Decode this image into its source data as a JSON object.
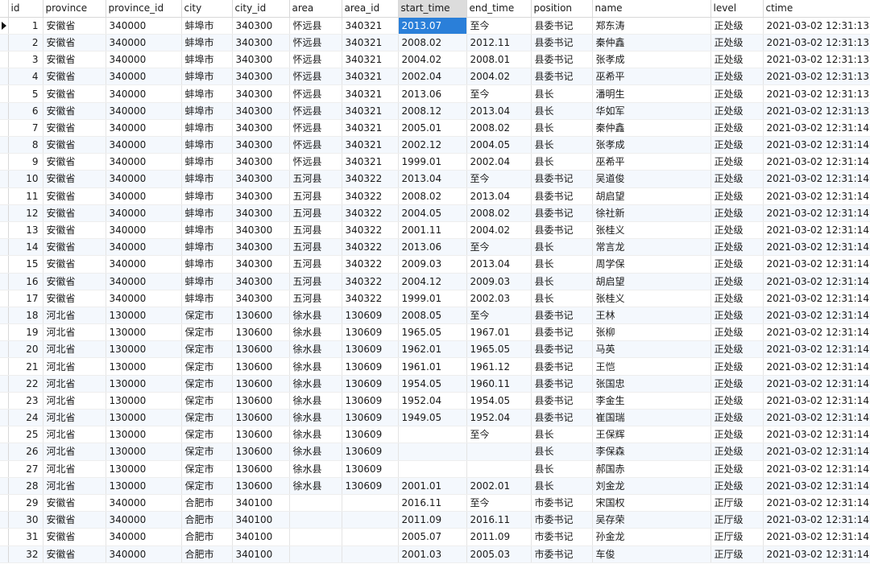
{
  "columns": [
    {
      "key": "id",
      "label": "id"
    },
    {
      "key": "province",
      "label": "province"
    },
    {
      "key": "province_id",
      "label": "province_id"
    },
    {
      "key": "city",
      "label": "city"
    },
    {
      "key": "city_id",
      "label": "city_id"
    },
    {
      "key": "area",
      "label": "area"
    },
    {
      "key": "area_id",
      "label": "area_id"
    },
    {
      "key": "start_time",
      "label": "start_time"
    },
    {
      "key": "end_time",
      "label": "end_time"
    },
    {
      "key": "position",
      "label": "position"
    },
    {
      "key": "name",
      "label": "name"
    },
    {
      "key": "level",
      "label": "level"
    },
    {
      "key": "ctime",
      "label": "ctime"
    }
  ],
  "sorted_column": "start_time",
  "current_row_index": 0,
  "selected_cell": {
    "row": 0,
    "column": "start_time"
  },
  "colors": {
    "selection": "#2a7fd9",
    "header_sorted": "#dcdcdc",
    "row_alt": "#f4f8fd"
  },
  "rows": [
    {
      "id": "1",
      "province": "安徽省",
      "province_id": "340000",
      "city": "蚌埠市",
      "city_id": "340300",
      "area": "怀远县",
      "area_id": "340321",
      "start_time": "2013.07",
      "end_time": "至今",
      "position": "县委书记",
      "name": "郑东涛",
      "level": "正处级",
      "ctime": "2021-03-02 12:31:13"
    },
    {
      "id": "2",
      "province": "安徽省",
      "province_id": "340000",
      "city": "蚌埠市",
      "city_id": "340300",
      "area": "怀远县",
      "area_id": "340321",
      "start_time": "2008.02",
      "end_time": "2012.11",
      "position": "县委书记",
      "name": "秦仲鑫",
      "level": "正处级",
      "ctime": "2021-03-02 12:31:13"
    },
    {
      "id": "3",
      "province": "安徽省",
      "province_id": "340000",
      "city": "蚌埠市",
      "city_id": "340300",
      "area": "怀远县",
      "area_id": "340321",
      "start_time": "2004.02",
      "end_time": "2008.01",
      "position": "县委书记",
      "name": "张孝成",
      "level": "正处级",
      "ctime": "2021-03-02 12:31:13"
    },
    {
      "id": "4",
      "province": "安徽省",
      "province_id": "340000",
      "city": "蚌埠市",
      "city_id": "340300",
      "area": "怀远县",
      "area_id": "340321",
      "start_time": "2002.04",
      "end_time": "2004.02",
      "position": "县委书记",
      "name": "巫希平",
      "level": "正处级",
      "ctime": "2021-03-02 12:31:13"
    },
    {
      "id": "5",
      "province": "安徽省",
      "province_id": "340000",
      "city": "蚌埠市",
      "city_id": "340300",
      "area": "怀远县",
      "area_id": "340321",
      "start_time": "2013.06",
      "end_time": "至今",
      "position": "县长",
      "name": "潘明生",
      "level": "正处级",
      "ctime": "2021-03-02 12:31:13"
    },
    {
      "id": "6",
      "province": "安徽省",
      "province_id": "340000",
      "city": "蚌埠市",
      "city_id": "340300",
      "area": "怀远县",
      "area_id": "340321",
      "start_time": "2008.12",
      "end_time": "2013.04",
      "position": "县长",
      "name": "华如军",
      "level": "正处级",
      "ctime": "2021-03-02 12:31:13"
    },
    {
      "id": "7",
      "province": "安徽省",
      "province_id": "340000",
      "city": "蚌埠市",
      "city_id": "340300",
      "area": "怀远县",
      "area_id": "340321",
      "start_time": "2005.01",
      "end_time": "2008.02",
      "position": "县长",
      "name": "秦仲鑫",
      "level": "正处级",
      "ctime": "2021-03-02 12:31:14"
    },
    {
      "id": "8",
      "province": "安徽省",
      "province_id": "340000",
      "city": "蚌埠市",
      "city_id": "340300",
      "area": "怀远县",
      "area_id": "340321",
      "start_time": "2002.12",
      "end_time": "2004.05",
      "position": "县长",
      "name": "张孝成",
      "level": "正处级",
      "ctime": "2021-03-02 12:31:14"
    },
    {
      "id": "9",
      "province": "安徽省",
      "province_id": "340000",
      "city": "蚌埠市",
      "city_id": "340300",
      "area": "怀远县",
      "area_id": "340321",
      "start_time": "1999.01",
      "end_time": "2002.04",
      "position": "县长",
      "name": "巫希平",
      "level": "正处级",
      "ctime": "2021-03-02 12:31:14"
    },
    {
      "id": "10",
      "province": "安徽省",
      "province_id": "340000",
      "city": "蚌埠市",
      "city_id": "340300",
      "area": "五河县",
      "area_id": "340322",
      "start_time": "2013.04",
      "end_time": "至今",
      "position": "县委书记",
      "name": "吴道俊",
      "level": "正处级",
      "ctime": "2021-03-02 12:31:14"
    },
    {
      "id": "11",
      "province": "安徽省",
      "province_id": "340000",
      "city": "蚌埠市",
      "city_id": "340300",
      "area": "五河县",
      "area_id": "340322",
      "start_time": "2008.02",
      "end_time": "2013.04",
      "position": "县委书记",
      "name": "胡启望",
      "level": "正处级",
      "ctime": "2021-03-02 12:31:14"
    },
    {
      "id": "12",
      "province": "安徽省",
      "province_id": "340000",
      "city": "蚌埠市",
      "city_id": "340300",
      "area": "五河县",
      "area_id": "340322",
      "start_time": "2004.05",
      "end_time": "2008.02",
      "position": "县委书记",
      "name": "徐社新",
      "level": "正处级",
      "ctime": "2021-03-02 12:31:14"
    },
    {
      "id": "13",
      "province": "安徽省",
      "province_id": "340000",
      "city": "蚌埠市",
      "city_id": "340300",
      "area": "五河县",
      "area_id": "340322",
      "start_time": "2001.11",
      "end_time": "2004.02",
      "position": "县委书记",
      "name": "张桂义",
      "level": "正处级",
      "ctime": "2021-03-02 12:31:14"
    },
    {
      "id": "14",
      "province": "安徽省",
      "province_id": "340000",
      "city": "蚌埠市",
      "city_id": "340300",
      "area": "五河县",
      "area_id": "340322",
      "start_time": "2013.06",
      "end_time": "至今",
      "position": "县长",
      "name": "常言龙",
      "level": "正处级",
      "ctime": "2021-03-02 12:31:14"
    },
    {
      "id": "15",
      "province": "安徽省",
      "province_id": "340000",
      "city": "蚌埠市",
      "city_id": "340300",
      "area": "五河县",
      "area_id": "340322",
      "start_time": "2009.03",
      "end_time": "2013.04",
      "position": "县长",
      "name": "周学保",
      "level": "正处级",
      "ctime": "2021-03-02 12:31:14"
    },
    {
      "id": "16",
      "province": "安徽省",
      "province_id": "340000",
      "city": "蚌埠市",
      "city_id": "340300",
      "area": "五河县",
      "area_id": "340322",
      "start_time": "2004.12",
      "end_time": "2009.03",
      "position": "县长",
      "name": "胡启望",
      "level": "正处级",
      "ctime": "2021-03-02 12:31:14"
    },
    {
      "id": "17",
      "province": "安徽省",
      "province_id": "340000",
      "city": "蚌埠市",
      "city_id": "340300",
      "area": "五河县",
      "area_id": "340322",
      "start_time": "1999.01",
      "end_time": "2002.03",
      "position": "县长",
      "name": "张桂义",
      "level": "正处级",
      "ctime": "2021-03-02 12:31:14"
    },
    {
      "id": "18",
      "province": "河北省",
      "province_id": "130000",
      "city": "保定市",
      "city_id": "130600",
      "area": "徐水县",
      "area_id": "130609",
      "start_time": "2008.05",
      "end_time": "至今",
      "position": "县委书记",
      "name": "王林",
      "level": "正处级",
      "ctime": "2021-03-02 12:31:14"
    },
    {
      "id": "19",
      "province": "河北省",
      "province_id": "130000",
      "city": "保定市",
      "city_id": "130600",
      "area": "徐水县",
      "area_id": "130609",
      "start_time": "1965.05",
      "end_time": "1967.01",
      "position": "县委书记",
      "name": "张柳",
      "level": "正处级",
      "ctime": "2021-03-02 12:31:14"
    },
    {
      "id": "20",
      "province": "河北省",
      "province_id": "130000",
      "city": "保定市",
      "city_id": "130600",
      "area": "徐水县",
      "area_id": "130609",
      "start_time": "1962.01",
      "end_time": "1965.05",
      "position": "县委书记",
      "name": "马英",
      "level": "正处级",
      "ctime": "2021-03-02 12:31:14"
    },
    {
      "id": "21",
      "province": "河北省",
      "province_id": "130000",
      "city": "保定市",
      "city_id": "130600",
      "area": "徐水县",
      "area_id": "130609",
      "start_time": "1961.01",
      "end_time": "1961.12",
      "position": "县委书记",
      "name": "王恺",
      "level": "正处级",
      "ctime": "2021-03-02 12:31:14"
    },
    {
      "id": "22",
      "province": "河北省",
      "province_id": "130000",
      "city": "保定市",
      "city_id": "130600",
      "area": "徐水县",
      "area_id": "130609",
      "start_time": "1954.05",
      "end_time": "1960.11",
      "position": "县委书记",
      "name": "张国忠",
      "level": "正处级",
      "ctime": "2021-03-02 12:31:14"
    },
    {
      "id": "23",
      "province": "河北省",
      "province_id": "130000",
      "city": "保定市",
      "city_id": "130600",
      "area": "徐水县",
      "area_id": "130609",
      "start_time": "1952.04",
      "end_time": "1954.05",
      "position": "县委书记",
      "name": "李金生",
      "level": "正处级",
      "ctime": "2021-03-02 12:31:14"
    },
    {
      "id": "24",
      "province": "河北省",
      "province_id": "130000",
      "city": "保定市",
      "city_id": "130600",
      "area": "徐水县",
      "area_id": "130609",
      "start_time": "1949.05",
      "end_time": "1952.04",
      "position": "县委书记",
      "name": "崔国瑞",
      "level": "正处级",
      "ctime": "2021-03-02 12:31:14"
    },
    {
      "id": "25",
      "province": "河北省",
      "province_id": "130000",
      "city": "保定市",
      "city_id": "130600",
      "area": "徐水县",
      "area_id": "130609",
      "start_time": "",
      "end_time": "至今",
      "position": "县长",
      "name": "王保辉",
      "level": "正处级",
      "ctime": "2021-03-02 12:31:14"
    },
    {
      "id": "26",
      "province": "河北省",
      "province_id": "130000",
      "city": "保定市",
      "city_id": "130600",
      "area": "徐水县",
      "area_id": "130609",
      "start_time": "",
      "end_time": "",
      "position": "县长",
      "name": "李保森",
      "level": "正处级",
      "ctime": "2021-03-02 12:31:14"
    },
    {
      "id": "27",
      "province": "河北省",
      "province_id": "130000",
      "city": "保定市",
      "city_id": "130600",
      "area": "徐水县",
      "area_id": "130609",
      "start_time": "",
      "end_time": "",
      "position": "县长",
      "name": "郝国赤",
      "level": "正处级",
      "ctime": "2021-03-02 12:31:14"
    },
    {
      "id": "28",
      "province": "河北省",
      "province_id": "130000",
      "city": "保定市",
      "city_id": "130600",
      "area": "徐水县",
      "area_id": "130609",
      "start_time": "2001.01",
      "end_time": "2002.01",
      "position": "县长",
      "name": "刘金龙",
      "level": "正处级",
      "ctime": "2021-03-02 12:31:14"
    },
    {
      "id": "29",
      "province": "安徽省",
      "province_id": "340000",
      "city": "合肥市",
      "city_id": "340100",
      "area": "",
      "area_id": "",
      "start_time": "2016.11",
      "end_time": "至今",
      "position": "市委书记",
      "name": "宋国权",
      "level": "正厅级",
      "ctime": "2021-03-02 12:31:14"
    },
    {
      "id": "30",
      "province": "安徽省",
      "province_id": "340000",
      "city": "合肥市",
      "city_id": "340100",
      "area": "",
      "area_id": "",
      "start_time": "2011.09",
      "end_time": "2016.11",
      "position": "市委书记",
      "name": "吴存荣",
      "level": "正厅级",
      "ctime": "2021-03-02 12:31:14"
    },
    {
      "id": "31",
      "province": "安徽省",
      "province_id": "340000",
      "city": "合肥市",
      "city_id": "340100",
      "area": "",
      "area_id": "",
      "start_time": "2005.07",
      "end_time": "2011.09",
      "position": "市委书记",
      "name": "孙金龙",
      "level": "正厅级",
      "ctime": "2021-03-02 12:31:14"
    },
    {
      "id": "32",
      "province": "安徽省",
      "province_id": "340000",
      "city": "合肥市",
      "city_id": "340100",
      "area": "",
      "area_id": "",
      "start_time": "2001.03",
      "end_time": "2005.03",
      "position": "市委书记",
      "name": "车俊",
      "level": "正厅级",
      "ctime": "2021-03-02 12:31:14"
    }
  ]
}
